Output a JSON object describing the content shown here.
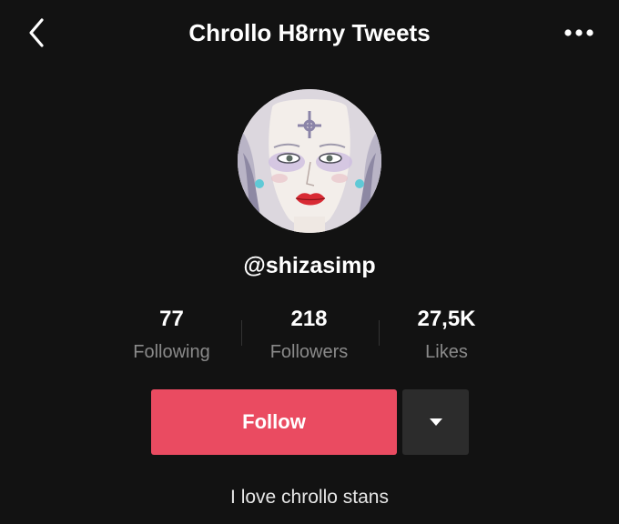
{
  "header": {
    "title": "Chrollo H8rny Tweets",
    "back_icon": "chevron-left-icon",
    "more_icon": "more-dots-icon"
  },
  "profile": {
    "username": "@shizasimp",
    "bio": "I love chrollo stans"
  },
  "stats": [
    {
      "value": "77",
      "label": "Following"
    },
    {
      "value": "218",
      "label": "Followers"
    },
    {
      "value": "27,5K",
      "label": "Likes"
    }
  ],
  "actions": {
    "follow_label": "Follow",
    "dropdown_icon": "caret-down-icon"
  },
  "colors": {
    "background": "#121212",
    "follow_button": "#ea4b61",
    "dropdown_button": "#2c2c2c",
    "secondary_text": "#8a8a8a"
  }
}
